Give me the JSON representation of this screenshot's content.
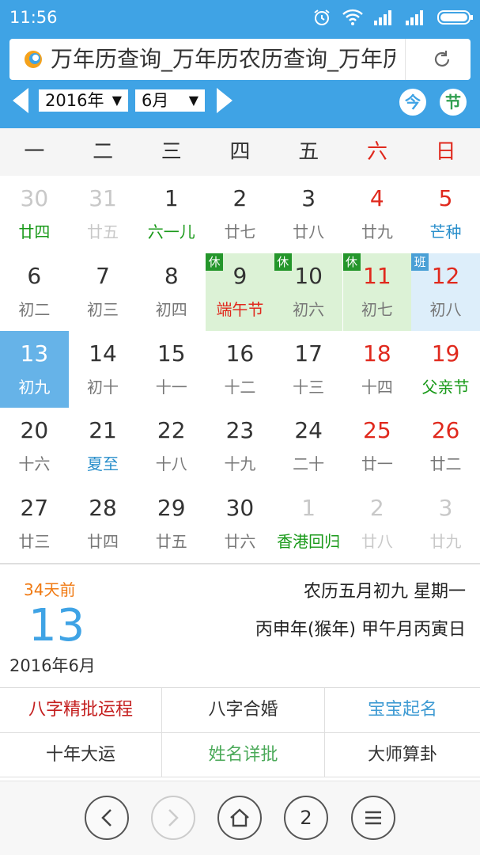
{
  "status": {
    "time": "11:56"
  },
  "browser": {
    "url_title": "万年历查询_万年历农历查询_万年历"
  },
  "selector": {
    "year": "2016年",
    "month": "6月",
    "today_btn": "今",
    "festival_btn": "节"
  },
  "weekdays": [
    "一",
    "二",
    "三",
    "四",
    "五",
    "六",
    "日"
  ],
  "calendar": {
    "cells": [
      {
        "day": "30",
        "lunar": "廿四"
      },
      {
        "day": "31",
        "lunar": "廿五"
      },
      {
        "day": "1",
        "lunar": "六一儿"
      },
      {
        "day": "2",
        "lunar": "廿七"
      },
      {
        "day": "3",
        "lunar": "廿八"
      },
      {
        "day": "4",
        "lunar": "廿九"
      },
      {
        "day": "5",
        "lunar": "芒种"
      },
      {
        "day": "6",
        "lunar": "初二"
      },
      {
        "day": "7",
        "lunar": "初三"
      },
      {
        "day": "8",
        "lunar": "初四"
      },
      {
        "day": "9",
        "lunar": "端午节",
        "tag": "休"
      },
      {
        "day": "10",
        "lunar": "初六",
        "tag": "休"
      },
      {
        "day": "11",
        "lunar": "初七",
        "tag": "休"
      },
      {
        "day": "12",
        "lunar": "初八",
        "tag": "班"
      },
      {
        "day": "13",
        "lunar": "初九"
      },
      {
        "day": "14",
        "lunar": "初十"
      },
      {
        "day": "15",
        "lunar": "十一"
      },
      {
        "day": "16",
        "lunar": "十二"
      },
      {
        "day": "17",
        "lunar": "十三"
      },
      {
        "day": "18",
        "lunar": "十四"
      },
      {
        "day": "19",
        "lunar": "父亲节"
      },
      {
        "day": "20",
        "lunar": "十六"
      },
      {
        "day": "21",
        "lunar": "夏至"
      },
      {
        "day": "22",
        "lunar": "十八"
      },
      {
        "day": "23",
        "lunar": "十九"
      },
      {
        "day": "24",
        "lunar": "二十"
      },
      {
        "day": "25",
        "lunar": "廿一"
      },
      {
        "day": "26",
        "lunar": "廿二"
      },
      {
        "day": "27",
        "lunar": "廿三"
      },
      {
        "day": "28",
        "lunar": "廿四"
      },
      {
        "day": "29",
        "lunar": "廿五"
      },
      {
        "day": "30",
        "lunar": "廿六"
      },
      {
        "day": "1",
        "lunar": "香港回归"
      },
      {
        "day": "2",
        "lunar": "廿八"
      },
      {
        "day": "3",
        "lunar": "廿九"
      }
    ]
  },
  "info": {
    "days_ago": "34天前",
    "big_day": "13",
    "year_month": "2016年6月",
    "lunar_date": "农历五月初九  星期一",
    "ganzhi": "丙申年(猴年)  甲午月丙寅日"
  },
  "services": {
    "bazi": "八字精批运程",
    "hehun": "八字合婚",
    "baby_name": "宝宝起名",
    "dayun": "十年大运",
    "name_detail": "姓名详批",
    "master": "大师算卦"
  },
  "nav": {
    "tabs_count": "2"
  },
  "colors": {
    "primary": "#3fa3e5",
    "weekend_red": "#e0291d",
    "festival_green": "#1a9a1a",
    "holiday_bg": "#dcf2d6",
    "today_bg": "#66b3e8"
  }
}
